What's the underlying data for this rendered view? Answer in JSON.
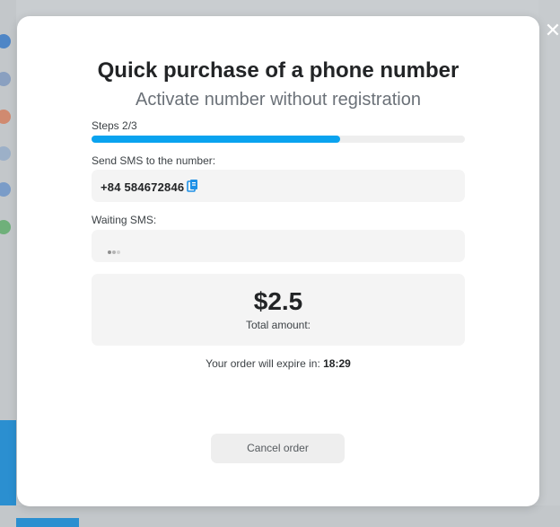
{
  "modal": {
    "title": "Quick purchase of a phone number",
    "subtitle": "Activate number without registration",
    "steps_label": "Steps 2/3",
    "progress_fraction": 0.665,
    "send_sms_label": "Send SMS to the number:",
    "phone_number": "+84  584672846",
    "waiting_label": "Waiting SMS:",
    "price": "$2.5",
    "total_label": "Total amount:",
    "expire_prefix": "Your order will expire in:",
    "expire_time": "18:29",
    "cancel_label": "Cancel order"
  },
  "colors": {
    "accent": "#0aa3ef",
    "copy_icon": "#1e90e6"
  },
  "icons": {
    "close": "close-icon",
    "copy": "copy-icon",
    "loading": "loading-dots-icon"
  }
}
